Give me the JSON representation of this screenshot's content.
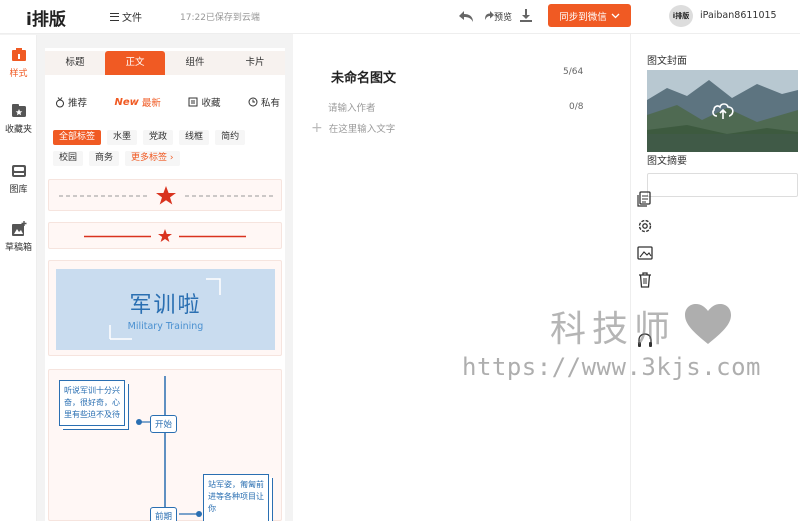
{
  "header": {
    "logo": "i排版",
    "file_menu": "文件",
    "save_status": "17:22已保存到云端",
    "preview_label": "预览",
    "sync_button": "同步到微信",
    "avatar_text": "i排版",
    "username": "iPaiban8611015"
  },
  "left_nav": {
    "items": [
      {
        "label": "样式",
        "icon": "style-icon"
      },
      {
        "label": "收藏夹",
        "icon": "favorites-icon"
      },
      {
        "label": "图库",
        "icon": "gallery-icon"
      },
      {
        "label": "草稿箱",
        "icon": "drafts-icon"
      }
    ]
  },
  "style_panel": {
    "tabs": [
      "标题",
      "正文",
      "组件",
      "卡片"
    ],
    "active_tab": "正文",
    "filters": {
      "recommend": "推荐",
      "newest_badge": "New",
      "newest": "最新",
      "favorites": "收藏",
      "private": "私有"
    },
    "tags_row1": [
      "全部标签",
      "水墨",
      "党政",
      "线框",
      "简约"
    ],
    "tags_row2": [
      "校园",
      "商务"
    ],
    "more_tags": "更多标签 ›",
    "template_military": {
      "title": "军训啦",
      "subtitle": "Military Training"
    },
    "template_timeline": {
      "note1": "听说军训十分兴奋，很好奇，心里有些迫不及待",
      "node1": "开始",
      "note2": "站军姿，匍匐前进等各种项目让你",
      "node2": "前期"
    }
  },
  "editor": {
    "title": "未命名图文",
    "title_count": "5/64",
    "author_placeholder": "请输入作者",
    "author_count": "0/8",
    "body_placeholder": "在这里输入文字"
  },
  "right_panel": {
    "cover_label": "图文封面",
    "summary_label": "图文摘要"
  },
  "watermark": {
    "cn": "科技师",
    "url": "https://www.3kjs.com"
  },
  "colors": {
    "accent": "#f05a23",
    "template_blue": "#2a6fb2"
  }
}
